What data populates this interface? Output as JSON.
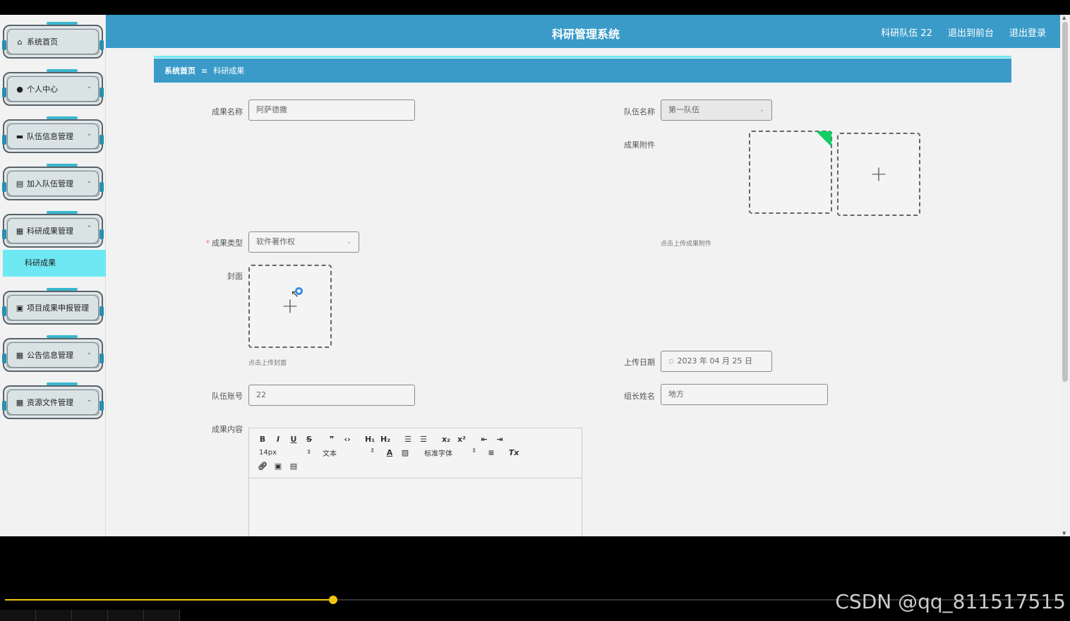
{
  "header": {
    "title": "科研管理系统",
    "team_user": "科研队伍 22",
    "front_link": "退出到前台",
    "logout_link": "退出登录"
  },
  "sidebar": {
    "items": [
      {
        "label": "系统首页",
        "icon": "home-icon"
      },
      {
        "label": "个人中心",
        "icon": "user-icon"
      },
      {
        "label": "队伍信息管理",
        "icon": "monitor-icon"
      },
      {
        "label": "加入队伍管理",
        "icon": "clipboard-icon"
      },
      {
        "label": "科研成果管理",
        "icon": "grid-icon"
      },
      {
        "label": "项目成果申报管理",
        "icon": "briefcase-icon"
      },
      {
        "label": "公告信息管理",
        "icon": "grid-icon"
      },
      {
        "label": "资源文件管理",
        "icon": "grid-icon"
      }
    ],
    "sub_item": "科研成果"
  },
  "breadcrumb": {
    "home": "系统首页",
    "separator": "≡",
    "current": "科研成果"
  },
  "form": {
    "name_label": "成果名称",
    "name_value": "阿萨德撒",
    "team_label": "队伍名称",
    "team_value": "第一队伍",
    "attach_label": "成果附件",
    "attach_tip": "点击上传成果附件",
    "type_label": "成果类型",
    "type_value": "软件著作权",
    "cover_label": "封面",
    "cover_tip": "点击上传封面",
    "date_label": "上传日期",
    "date_value": "2023 年 04 月 25 日",
    "account_label": "队伍账号",
    "account_value": "22",
    "leader_label": "组长姓名",
    "leader_value": "地方",
    "content_label": "成果内容"
  },
  "editor": {
    "font_size": "14px",
    "paragraph": "文本",
    "font_family": "标准字体"
  },
  "player": {
    "progress_fraction": 0.31,
    "watermark": "CSDN @qq_811517515"
  },
  "colors": {
    "header_bg": "#3a9bc9",
    "submenu_bg": "#6ee8f3",
    "progress": "#f1c40f"
  }
}
